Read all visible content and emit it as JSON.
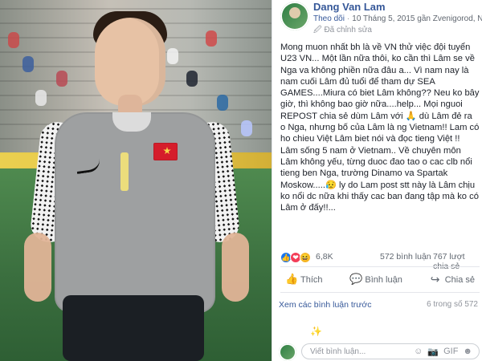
{
  "post": {
    "author": "Dang Van Lam",
    "follow_label": "Theo dõi",
    "date_location": "10 Tháng 5, 2015 gần Zvenigorod, Nga",
    "edited_label": "Đã chỉnh sửa",
    "text": "Mong muon nhất bh là về VN thử việc đội tuyển U23 VN... Một lần nữa thôi, ko cần thì Lâm se về Nga va không phiền nữa đâu a... Vì nam nay là nam cuối Lâm đủ tuổi để tham dự SEA GAMES....Miura có biet Lâm không?? Neu ko bây giờ, thì không bao giờ nữa....help... Mọi nguoi REPOST chia sẻ dùm Lâm với 🙏 dù Lâm đẻ ra o Nga, nhưng bố của Lâm là ng Vietnam!! Lam có ho chieu Việt Lâm biet nói và đọc tieng Việt !! Lâm sống 5 nam ở Vietnam.. Về chuyên môn Lâm không yếu, từng duoc đao tao o cac clb nổi tieng ben Nga, trường Dinamo va Spartak Moskow.....😥 ly do Lam post stt này là Lâm chịu ko nổi dc nữa khi thấy cac ban đang tập mà ko có Lâm ở đấy!!...",
    "reaction_count": "6,8K",
    "comment_count": "572 bình luận",
    "share_count": "767 lượt chia sẻ",
    "actions": {
      "like": "Thích",
      "comment": "Bình luận",
      "share": "Chia sẻ"
    },
    "view_previous": "Xem các bình luận trước",
    "comments_shown": "6 trong số 572",
    "comment_placeholder": "Viết bình luận..."
  }
}
